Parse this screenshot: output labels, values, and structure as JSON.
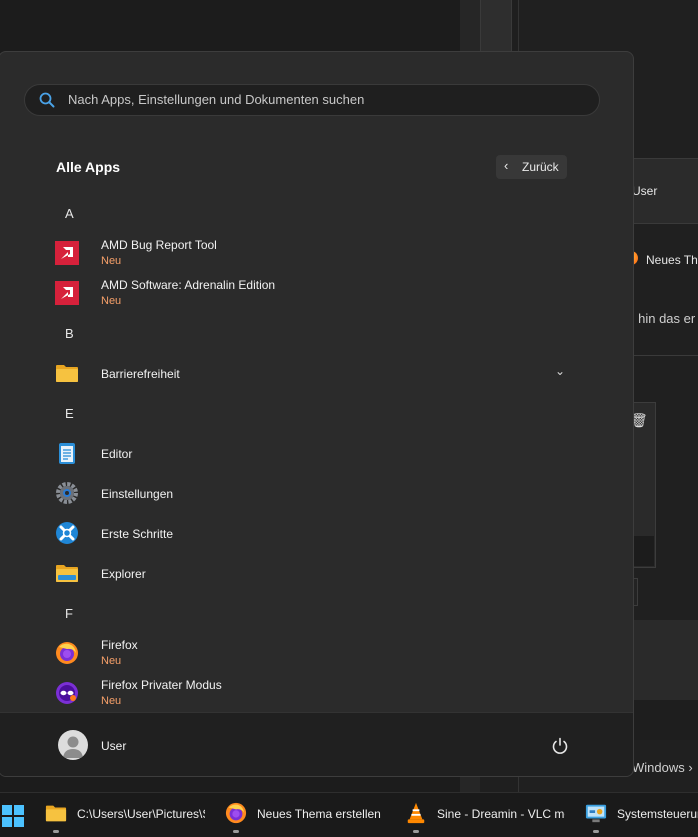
{
  "background": {
    "user_label": "User",
    "thread_title": "Neues The",
    "thread_text": "s hin das er",
    "windows_link": "Windows",
    "windows_chevron": "›"
  },
  "start_menu": {
    "search": {
      "placeholder": "Nach Apps, Einstellungen und Dokumenten suchen"
    },
    "section_title": "Alle Apps",
    "back_button": {
      "chevron": "‹",
      "label": "Zurück"
    },
    "groups": [
      {
        "letter": "A",
        "apps": [
          {
            "name": "AMD Bug Report Tool",
            "badge": "Neu",
            "icon": "amd-icon"
          },
          {
            "name": "AMD Software: Adrenalin Edition",
            "badge": "Neu",
            "icon": "amd-icon"
          }
        ]
      },
      {
        "letter": "B",
        "apps": [
          {
            "name": "Barrierefreiheit",
            "icon": "folder-icon",
            "expandable": true
          }
        ]
      },
      {
        "letter": "E",
        "apps": [
          {
            "name": "Editor",
            "icon": "notepad-icon"
          },
          {
            "name": "Einstellungen",
            "icon": "gear-icon"
          },
          {
            "name": "Erste Schritte",
            "icon": "get-started-icon"
          },
          {
            "name": "Explorer",
            "icon": "file-explorer-icon"
          }
        ]
      },
      {
        "letter": "F",
        "apps": [
          {
            "name": "Firefox",
            "badge": "Neu",
            "icon": "firefox-icon"
          },
          {
            "name": "Firefox Privater Modus",
            "badge": "Neu",
            "icon": "firefox-private-icon"
          }
        ]
      }
    ],
    "footer": {
      "user_name": "User"
    }
  },
  "taskbar": {
    "items": [
      {
        "label": "C:\\Users\\User\\Pictures\\S",
        "icon": "folder-icon"
      },
      {
        "label": "Neues Thema erstellen |",
        "icon": "firefox-icon"
      },
      {
        "label": "Sine - Dreamin - VLC me",
        "icon": "vlc-icon"
      },
      {
        "label": "Systemsteuerun",
        "icon": "control-panel-icon"
      }
    ]
  },
  "colors": {
    "accent_new": "#f7a069",
    "amd_red": "#d6213b",
    "start_bg": "#2b2b2b"
  }
}
